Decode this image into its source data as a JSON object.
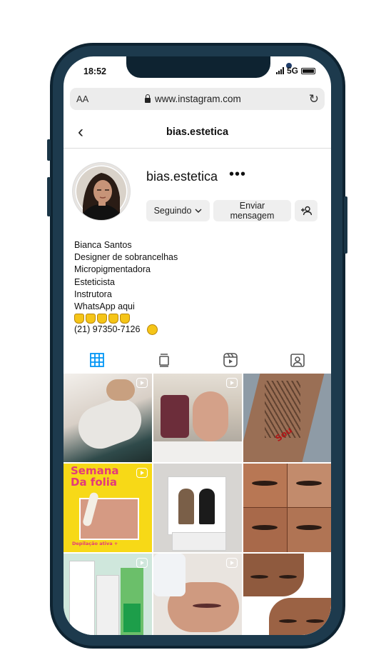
{
  "status": {
    "time": "18:52",
    "network": "5G"
  },
  "browser": {
    "aa": "AA",
    "url": "www.instagram.com"
  },
  "header": {
    "title": "bias.estetica"
  },
  "profile": {
    "username": "bias.estetica",
    "follow_label": "Seguindo",
    "message_label_line1": "Enviar",
    "message_label_line2": "mensagem"
  },
  "bio": {
    "lines": [
      "Bianca Santos",
      "Designer de sobrancelhas",
      "Micropigmentadora",
      "Esteticista",
      "Instrutora",
      "WhatsApp aqui"
    ],
    "phone": "(21) 97350-7126"
  },
  "tabs": [
    "grid-icon",
    "igtv-icon",
    "reels-icon",
    "tagged-icon"
  ],
  "colors": {
    "accent": "#0095f6",
    "button_bg": "#efefef",
    "phone_frame": "#0e2331"
  },
  "posts": [
    {
      "kind": "reel",
      "text": ""
    },
    {
      "kind": "reel",
      "text": ""
    },
    {
      "kind": "photo",
      "text": "Sou"
    },
    {
      "kind": "reel",
      "text": "Semana Da folia",
      "subtext": "Depilação ativa +"
    },
    {
      "kind": "photo",
      "text": ""
    },
    {
      "kind": "photo",
      "text": ""
    },
    {
      "kind": "reel",
      "text": ""
    },
    {
      "kind": "reel",
      "text": ""
    },
    {
      "kind": "photo",
      "text": ""
    }
  ]
}
